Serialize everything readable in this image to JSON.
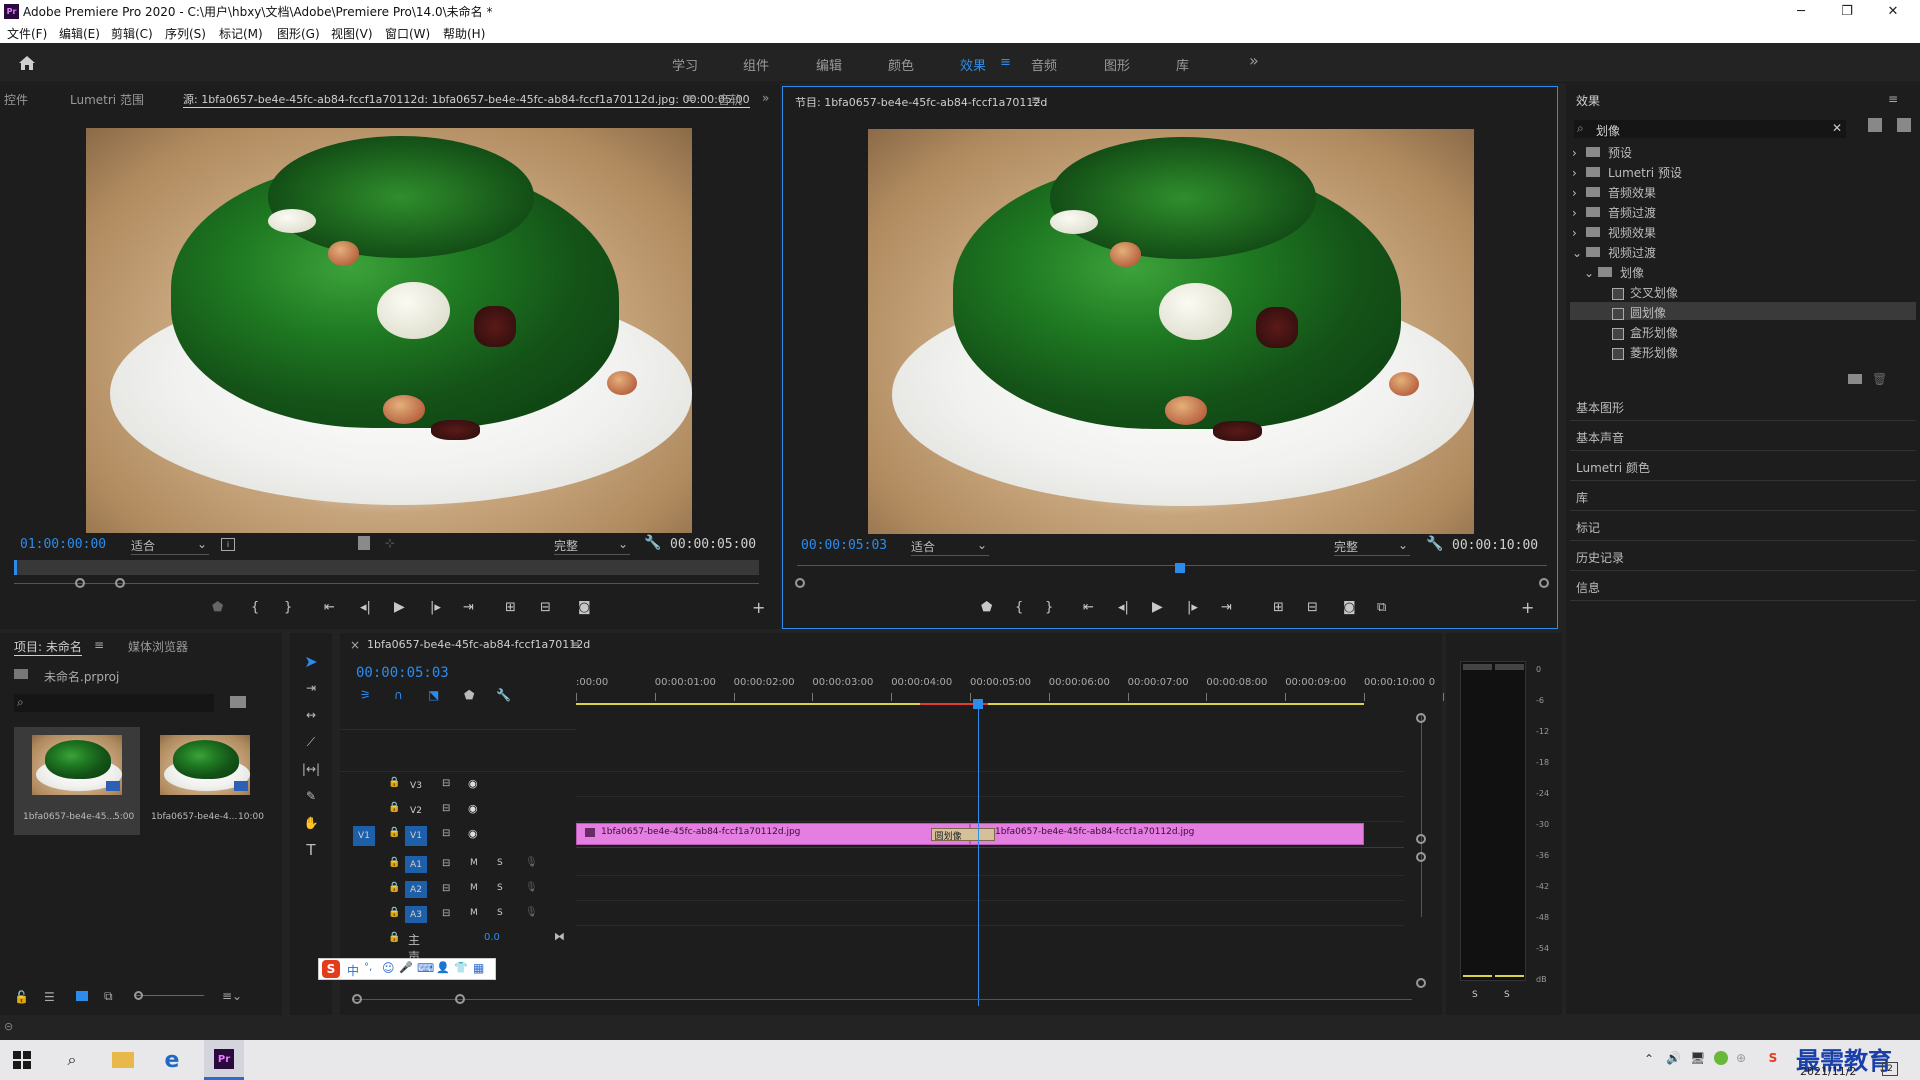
{
  "window": {
    "title": "Adobe Premiere Pro 2020 - C:\\用户\\hbxy\\文档\\Adobe\\Premiere Pro\\14.0\\未命名 *",
    "minimize": "─",
    "maximize": "❐",
    "close": "✕"
  },
  "menu": [
    "文件(F)",
    "编辑(E)",
    "剪辑(C)",
    "序列(S)",
    "标记(M)",
    "图形(G)",
    "视图(V)",
    "窗口(W)",
    "帮助(H)"
  ],
  "workspaces": [
    "学习",
    "组件",
    "编辑",
    "颜色",
    "效果",
    "音频",
    "图形",
    "库"
  ],
  "workspace_active": "效果",
  "more_glyph": "»",
  "source": {
    "tabs": [
      "控件",
      "Lumetri 范围",
      "源: 1bfa0657-be4e-45fc-ab84-fccf1a70112d: 1bfa0657-be4e-45fc-ab84-fccf1a70112d.jpg: 00:00:05:00",
      "音轨"
    ],
    "timecode": "01:00:00:00",
    "fit": "适合",
    "quality": "完整",
    "duration": "00:00:05:00"
  },
  "program": {
    "title": "节目: 1bfa0657-be4e-45fc-ab84-fccf1a70112d",
    "timecode": "00:00:05:03",
    "fit": "适合",
    "quality": "完整",
    "duration": "00:00:10:00"
  },
  "effects": {
    "title": "效果",
    "search_value": "划像",
    "tree": [
      {
        "label": "预设",
        "level": 0,
        "arrow": "›"
      },
      {
        "label": "Lumetri 预设",
        "level": 0,
        "arrow": "›"
      },
      {
        "label": "音频效果",
        "level": 0,
        "arrow": "›"
      },
      {
        "label": "音频过渡",
        "level": 0,
        "arrow": "›"
      },
      {
        "label": "视频效果",
        "level": 0,
        "arrow": "›"
      },
      {
        "label": "视频过渡",
        "level": 0,
        "arrow": "⌄"
      },
      {
        "label": "划像",
        "level": 1,
        "arrow": "⌄"
      },
      {
        "label": "交叉划像",
        "level": 2,
        "arrow": ""
      },
      {
        "label": "圆划像",
        "level": 2,
        "arrow": "",
        "selected": true
      },
      {
        "label": "盒形划像",
        "level": 2,
        "arrow": ""
      },
      {
        "label": "菱形划像",
        "level": 2,
        "arrow": ""
      }
    ],
    "sections": [
      "基本图形",
      "基本声音",
      "Lumetri 颜色",
      "库",
      "标记",
      "历史记录",
      "信息"
    ]
  },
  "project": {
    "tabs": [
      "项目: 未命名",
      "媒体浏览器"
    ],
    "file": "未命名.prproj",
    "items": [
      {
        "name": "1bfa0657-be4e-45...",
        "dur": "5:00"
      },
      {
        "name": "1bfa0657-be4e-4...",
        "dur": "10:00"
      }
    ]
  },
  "timeline": {
    "tab": "1bfa0657-be4e-45fc-ab84-fccf1a70112d",
    "timecode": "00:00:05:03",
    "ruler": [
      ":00:00",
      "00:00:01:00",
      "00:00:02:00",
      "00:00:03:00",
      "00:00:04:00",
      "00:00:05:00",
      "00:00:06:00",
      "00:00:07:00",
      "00:00:08:00",
      "00:00:09:00",
      "00:00:10:00",
      "0"
    ],
    "video_tracks": [
      "V3",
      "V2",
      "V1"
    ],
    "audio_tracks": [
      "A1",
      "A2",
      "A3"
    ],
    "v1_source": "V1",
    "mute": "M",
    "solo": "S",
    "master": {
      "label": "主声道",
      "value": "0.0"
    },
    "clip_a": "1bfa0657-be4e-45fc-ab84-fccf1a70112d.jpg",
    "clip_b": "1bfa0657-be4e-45fc-ab84-fccf1a70112d.jpg",
    "transition": "圆划像",
    "playhead_seconds": 5.1,
    "total_seconds": 10
  },
  "meter": {
    "scale": [
      "0",
      "-6",
      "-12",
      "-18",
      "-24",
      "-30",
      "-36",
      "-42",
      "-48",
      "-54",
      "dB"
    ],
    "solo": [
      "S",
      "S"
    ]
  },
  "ime": {
    "chars": [
      "中",
      "°,",
      "☺",
      "🎤",
      "⌨",
      "👤",
      "👕",
      "▦"
    ]
  },
  "watermark": "最需教育",
  "clock": {
    "date": "2021/11/2"
  },
  "colors": {
    "accent": "#2d8ceb",
    "clip": "#e47ee0",
    "transition": "#d6c09a",
    "playhead": "#2d8ceb",
    "yellow_bar": "#d8d34a",
    "red_bar": "#e03c32"
  }
}
